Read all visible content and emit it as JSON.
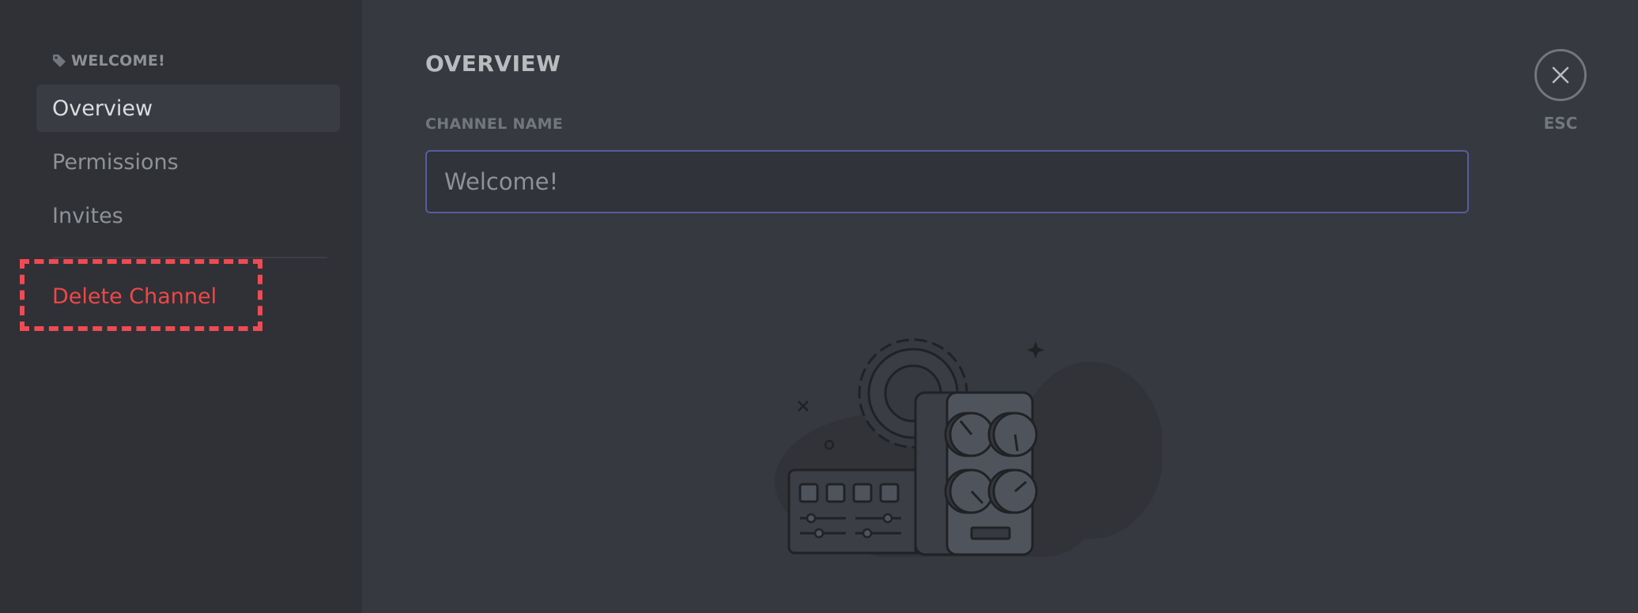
{
  "sidebar": {
    "header": "WELCOME!",
    "header_icon": "tag-icon",
    "items": [
      {
        "label": "Overview",
        "selected": true
      },
      {
        "label": "Permissions",
        "selected": false
      },
      {
        "label": "Invites",
        "selected": false
      }
    ],
    "danger_item": {
      "label": "Delete Channel",
      "color": "#f04747"
    }
  },
  "main": {
    "title": "OVERVIEW",
    "channel_name_label": "CHANNEL NAME",
    "channel_name_value": "Welcome!"
  },
  "close": {
    "icon": "close-icon",
    "label": "ESC"
  },
  "illustration": {
    "icon": "settings-console-illustration"
  },
  "colors": {
    "sidebar_bg": "#2f3136",
    "content_bg": "#36393f",
    "danger": "#f04747",
    "input_border": "#585c9e",
    "highlight": "#f04a52"
  }
}
